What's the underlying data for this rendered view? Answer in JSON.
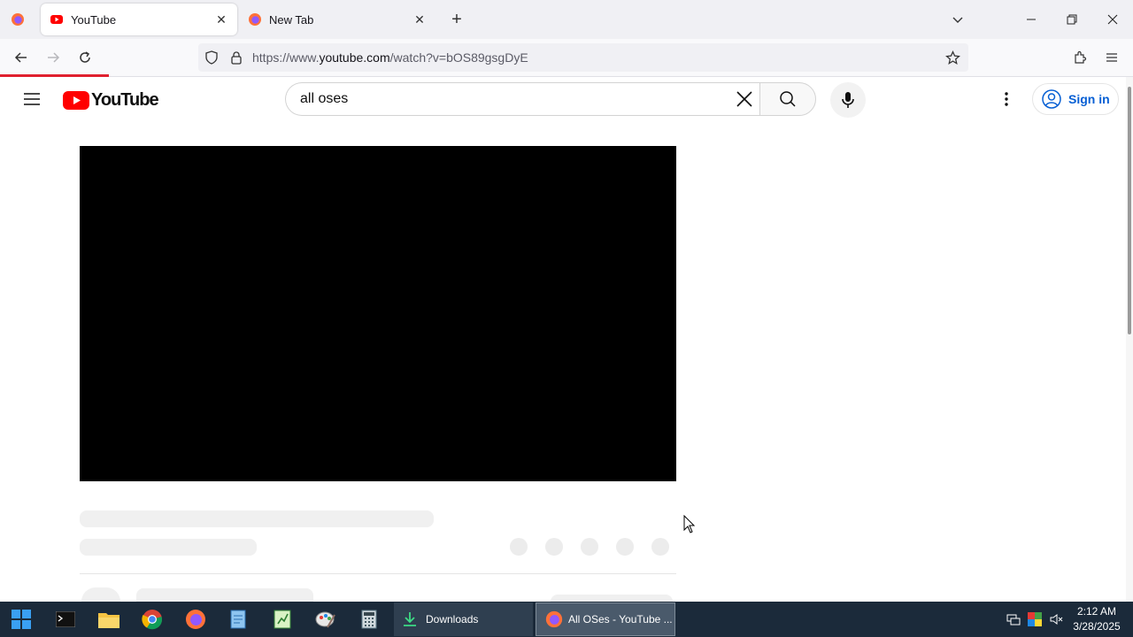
{
  "browser": {
    "tabs": [
      {
        "title": "YouTube",
        "active": true,
        "icon": "youtube-favicon-icon"
      },
      {
        "title": "New Tab",
        "active": false,
        "icon": "firefox-favicon-icon"
      }
    ],
    "url_prefix": "https://www.",
    "url_domain": "youtube.com",
    "url_rest": "/watch?v=bOS89gsgDyE"
  },
  "youtube": {
    "logo_text": "YouTube",
    "search_value": "all oses",
    "sign_in_label": "Sign in"
  },
  "taskbar": {
    "tasks": [
      {
        "label": "Downloads"
      },
      {
        "label": "All OSes - YouTube ..."
      }
    ],
    "time": "2:12 AM",
    "date": "3/28/2025"
  },
  "colors": {
    "accent": "#ff0000",
    "link": "#065fd4",
    "taskbar": "#1b2a3a"
  }
}
